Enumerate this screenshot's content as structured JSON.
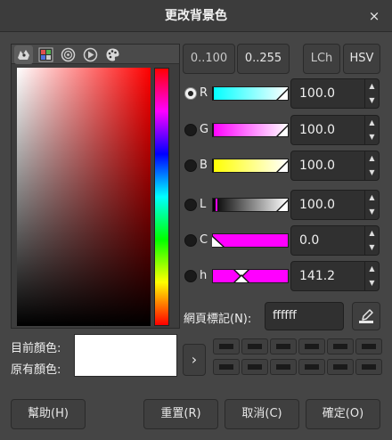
{
  "window": {
    "title": "更改背景色",
    "close_glyph": "×"
  },
  "tabs": [
    {
      "icon": "wilber-icon",
      "active": true
    },
    {
      "icon": "scales-icon",
      "active": false
    },
    {
      "icon": "color-wheel-icon",
      "active": false
    },
    {
      "icon": "triangle-icon",
      "active": false
    },
    {
      "icon": "palette-icon",
      "active": false
    }
  ],
  "scale_buttons": {
    "range_100": "0..100",
    "range_255": "0..255",
    "lch": "LCh",
    "hsv": "HSV"
  },
  "channels": [
    {
      "label": "R",
      "value": "100.0",
      "selected": true
    },
    {
      "label": "G",
      "value": "100.0",
      "selected": false
    },
    {
      "label": "B",
      "value": "100.0",
      "selected": false
    },
    {
      "label": "L",
      "value": "100.0",
      "selected": false
    },
    {
      "label": "C",
      "value": "0.0",
      "selected": false
    },
    {
      "label": "h",
      "value": "141.2",
      "selected": false
    }
  ],
  "hex": {
    "label": "網頁標記(N):",
    "value": "ffffff"
  },
  "swatches": {
    "current_label": "目前顏色:",
    "old_label": "原有顏色:",
    "current_color": "#ffffff",
    "old_color": "#ffffff"
  },
  "history_arrow": "›",
  "buttons": {
    "help": "幫助(H)",
    "reset": "重置(R)",
    "cancel": "取消(C)",
    "ok": "確定(O)"
  },
  "colors": {
    "background": "#454545",
    "sv_hue": "#ff0000"
  }
}
